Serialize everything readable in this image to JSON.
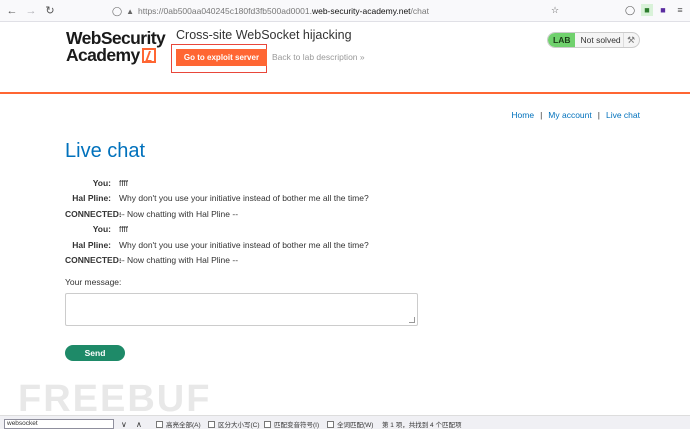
{
  "browser": {
    "url_prefix": "https://0ab500aa040245c180fd3fb500ad0001.",
    "url_domain": "web-security-academy.net",
    "url_path": "/chat"
  },
  "header": {
    "logo_line1": "WebSecurity",
    "logo_line2": "Academy",
    "lab_title": "Cross-site WebSocket hijacking",
    "exploit_button": "Go to exploit server",
    "back_link": "Back to lab description",
    "back_chevron": "»",
    "lab_badge": "LAB",
    "lab_status": "Not solved"
  },
  "nav": {
    "home": "Home",
    "sep1": "|",
    "account": "My account",
    "sep2": "|",
    "chat": "Live chat"
  },
  "page": {
    "title": "Live chat",
    "message_label": "Your message:",
    "send_button": "Send"
  },
  "chat": [
    {
      "who": "You:",
      "msg": "ffff"
    },
    {
      "who": "Hal Pline:",
      "msg": "Why don't you use your initiative instead of bother me all the time?"
    },
    {
      "who": "CONNECTED:",
      "msg": "-- Now chatting with Hal Pline --"
    },
    {
      "who": "You:",
      "msg": "ffff"
    },
    {
      "who": "Hal Pline:",
      "msg": "Why don't you use your initiative instead of bother me all the time?"
    },
    {
      "who": "CONNECTED:",
      "msg": "-- Now chatting with Hal Pline --"
    }
  ],
  "watermark": "FREEBUF",
  "findbar": {
    "query": "websocket",
    "highlight_all": "高亮全部(A)",
    "match_case": "区分大小写(C)",
    "match_diacritics": "匹配变音符号(I)",
    "whole_words": "全词匹配(W)",
    "result": "第 1 项，共找到 4 个匹配项"
  },
  "colors": {
    "accent": "#ff6633",
    "link": "#0071bc",
    "send": "#1e8a68",
    "lab": "#70d16d"
  }
}
